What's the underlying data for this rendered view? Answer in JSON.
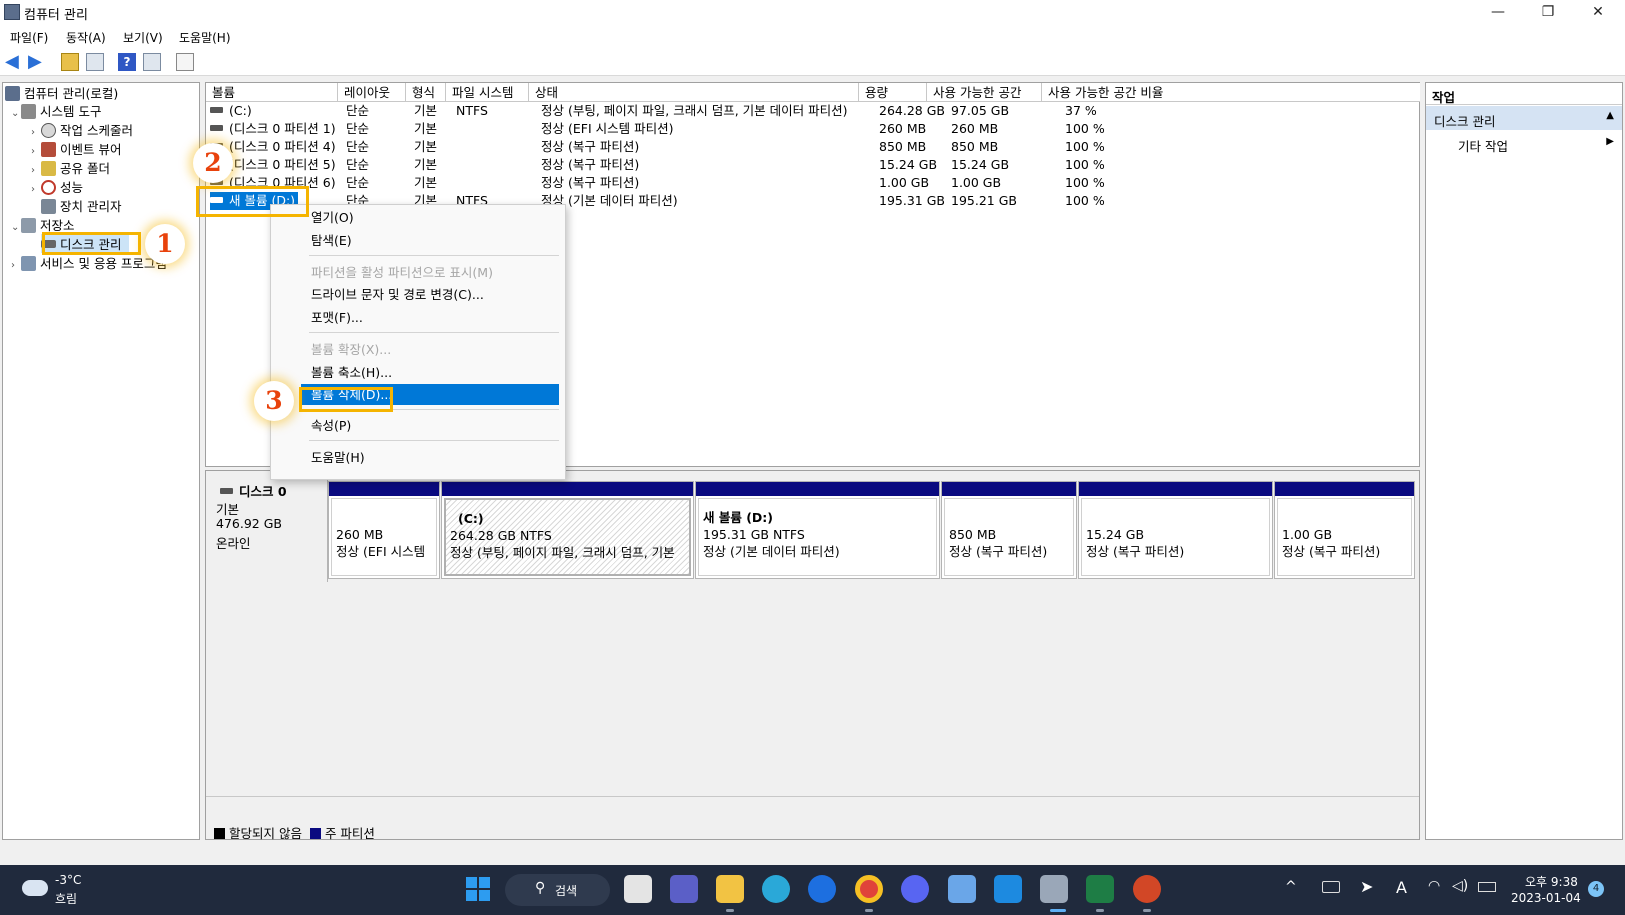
{
  "window": {
    "title": "컴퓨터 관리",
    "minimize": "—",
    "restore": "❐",
    "close": "✕"
  },
  "menu": [
    "파일(F)",
    "동작(A)",
    "보기(V)",
    "도움말(H)"
  ],
  "tree": {
    "root": "컴퓨터 관리(로컬)",
    "system_tools": "시스템 도구",
    "task_scheduler": "작업 스케줄러",
    "event_viewer": "이벤트 뷰어",
    "shared_folders": "공유 폴더",
    "performance": "성능",
    "device_manager": "장치 관리자",
    "storage": "저장소",
    "disk_management": "디스크 관리",
    "services": "서비스 및 응용 프로그램"
  },
  "volume_list": {
    "headers": [
      "볼륨",
      "레이아웃",
      "형식",
      "파일 시스템",
      "상태",
      "용량",
      "사용 가능한 공간",
      "사용 가능한 공간 비율"
    ],
    "rows": [
      {
        "volume": "(C:)",
        "layout": "단순",
        "type": "기본",
        "fs": "NTFS",
        "status": "정상 (부팅, 페이지 파일, 크래시 덤프, 기본 데이터 파티션)",
        "capacity": "264.28 GB",
        "free": "97.05 GB",
        "pct": "37 %"
      },
      {
        "volume": "(디스크 0 파티션 1)",
        "layout": "단순",
        "type": "기본",
        "fs": "",
        "status": "정상 (EFI 시스템 파티션)",
        "capacity": "260 MB",
        "free": "260 MB",
        "pct": "100 %"
      },
      {
        "volume": "(디스크 0 파티션 4)",
        "layout": "단순",
        "type": "기본",
        "fs": "",
        "status": "정상 (복구 파티션)",
        "capacity": "850 MB",
        "free": "850 MB",
        "pct": "100 %"
      },
      {
        "volume": "(디스크 0 파티션 5)",
        "layout": "단순",
        "type": "기본",
        "fs": "",
        "status": "정상 (복구 파티션)",
        "capacity": "15.24 GB",
        "free": "15.24 GB",
        "pct": "100 %"
      },
      {
        "volume": "(디스크 0 파티션 6)",
        "layout": "단순",
        "type": "기본",
        "fs": "",
        "status": "정상 (복구 파티션)",
        "capacity": "1.00 GB",
        "free": "1.00 GB",
        "pct": "100 %"
      },
      {
        "volume": "새 볼륨 (D:)",
        "layout": "단순",
        "type": "기본",
        "fs": "NTFS",
        "status": "정상 (기본 데이터 파티션)",
        "capacity": "195.31 GB",
        "free": "195.21 GB",
        "pct": "100 %"
      }
    ]
  },
  "context_menu": {
    "open": "열기(O)",
    "explore": "탐색(E)",
    "mark_active": "파티션을 활성 파티션으로 표시(M)",
    "change_letter": "드라이브 문자 및 경로 변경(C)...",
    "format": "포맷(F)...",
    "extend": "볼륨 확장(X)...",
    "shrink": "볼륨 축소(H)...",
    "delete": "볼륨 삭제(D)...",
    "properties": "속성(P)",
    "help": "도움말(H)"
  },
  "disk": {
    "name": "디스크 0",
    "type": "기본",
    "size": "476.92 GB",
    "state": "온라인",
    "partitions": [
      {
        "title": "",
        "size": "260 MB",
        "status": "정상 (EFI 시스템"
      },
      {
        "title": "(C:)",
        "size": "264.28 GB NTFS",
        "status": "정상 (부팅, 페이지 파일, 크래시 덤프, 기본"
      },
      {
        "title": "새 볼륨  (D:)",
        "size": "195.31 GB NTFS",
        "status": "정상 (기본 데이터 파티션)"
      },
      {
        "title": "",
        "size": "850 MB",
        "status": "정상 (복구 파티션)"
      },
      {
        "title": "",
        "size": "15.24 GB",
        "status": "정상 (복구 파티션)"
      },
      {
        "title": "",
        "size": "1.00 GB",
        "status": "정상 (복구 파티션)"
      }
    ]
  },
  "legend": {
    "unallocated": "할당되지 않음",
    "primary": "주 파티션"
  },
  "actions": {
    "header": "작업",
    "disk_management": "디스크 관리",
    "more": "기타 작업"
  },
  "annotations": [
    "1",
    "2",
    "3"
  ],
  "taskbar": {
    "temp": "-3°C",
    "weather": "흐림",
    "search": "검색",
    "time": "오후 9:38",
    "date": "2023-01-04",
    "notif_count": "4",
    "ime": "A"
  },
  "colors": {
    "selection": "#0078d7",
    "primary_partition": "#0a0a80",
    "highlight": "#f5b400",
    "badge_text": "#e8420c",
    "taskbar": "#202a3d"
  }
}
